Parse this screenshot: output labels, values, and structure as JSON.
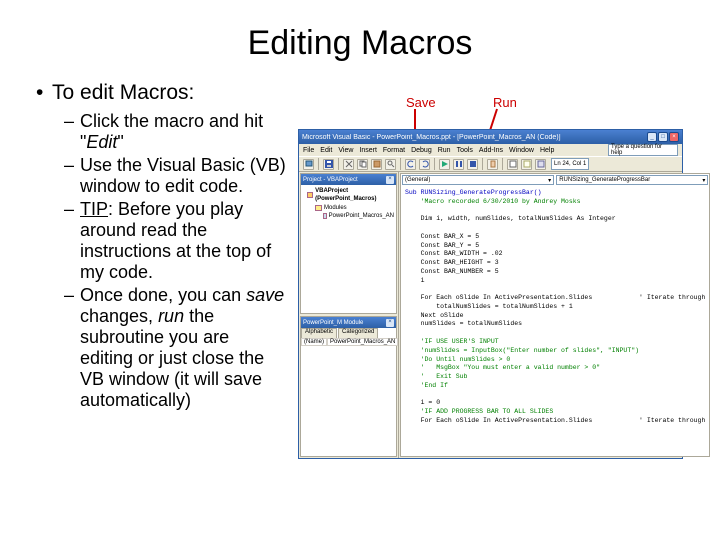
{
  "title": "Editing Macros",
  "bullets": {
    "main": "To edit Macros:",
    "sub": [
      {
        "pre": "Click the macro and hit \"",
        "em": "Edit",
        "post": "\""
      },
      {
        "pre": "Use the Visual Basic (VB) window to edit code.",
        "em": "",
        "post": ""
      },
      {
        "pre": "",
        "u": "TIP",
        "post": ": Before you play around read the instructions at the top of my code."
      },
      {
        "pre": "Once done, you can ",
        "em": "save",
        "post": " changes, ",
        "em2": "run",
        "post2": " the subroutine you are editing or just close the VB window (it will save automatically)"
      }
    ]
  },
  "callouts": {
    "save": "Save",
    "run": "Run"
  },
  "vb": {
    "title": "Microsoft Visual Basic - PowerPoint_Macros.ppt - [PowerPoint_Macros_AN (Code)]",
    "menu": [
      "File",
      "Edit",
      "View",
      "Insert",
      "Format",
      "Debug",
      "Run",
      "Tools",
      "Add-Ins",
      "Window",
      "Help"
    ],
    "question_placeholder": "Type a question for help",
    "toolbar_text": "Ln 24, Col 1",
    "project_pane": "Project - VBAProject",
    "project_root": "VBAProject (PowerPoint_Macros)",
    "modules_folder": "Modules",
    "module_name": "PowerPoint_Macros_AN",
    "props_pane": "PowerPoint_M Module",
    "props_tabs": [
      "Alphabetic",
      "Categorized"
    ],
    "props_name_label": "(Name)",
    "props_name_value": "PowerPoint_Macros_AN",
    "dd_left": "(General)",
    "dd_right": "RUNSizing_GenerateProgressBar",
    "code": {
      "l1": "Sub RUNSizing_GenerateProgressBar()",
      "l2": "    'Macro recorded 6/30/2010 by Andrey Mosks",
      "l3": "",
      "l4": "    Dim i, width, numSlides, totalNumSlides As Integer",
      "l5": "",
      "l6": "    Const BAR_X = 5",
      "l7": "    Const BAR_Y = 5",
      "l8": "    Const BAR_WIDTH = .02",
      "l9": "    Const BAR_HEIGHT = 3",
      "l10": "    Const BAR_NUMBER = 5",
      "l11": "    i",
      "l12": "",
      "l13": "    For Each oSlide In ActivePresentation.Slides            ' Iterate through",
      "l14": "        totalNumSlides = totalNumSlides + 1",
      "l15": "    Next oSlide",
      "l16": "    numSlides = totalNumSlides",
      "l17": "",
      "l18": "    'IF USE USER'S INPUT",
      "l19": "    'numSlides = InputBox(\"Enter number of slides\", \"INPUT\")",
      "l20": "    'Do Until numSlides > 0",
      "l21": "    '   MsgBox \"You must enter a valid number > 0\"",
      "l22": "    '   Exit Sub",
      "l23": "    'End If",
      "l24": "",
      "l25": "    i = 0",
      "l26": "    'IF ADD PROGRESS BAR TO ALL SLIDES",
      "l27": "    For Each oSlide In ActivePresentation.Slides            ' Iterate through"
    }
  }
}
